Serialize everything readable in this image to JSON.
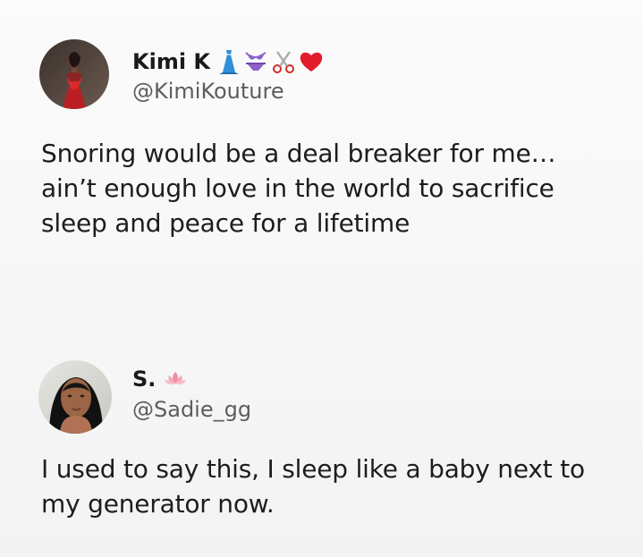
{
  "tweets": [
    {
      "display_name": "Kimi K",
      "name_emojis": [
        "dress-icon",
        "bikini-icon",
        "scissors-icon",
        "red-heart-icon"
      ],
      "handle": "@KimiKouture",
      "text": "Snoring would be a deal breaker for me…\nain’t enough love in the world to sacrifice\nsleep and peace for a lifetime"
    },
    {
      "display_name": "S.",
      "name_emojis": [
        "lotus-icon"
      ],
      "handle": "@Sadie_gg",
      "text": "I used to say this, I sleep like a baby next to\nmy generator now."
    }
  ],
  "colors": {
    "background": "#f7f7f7",
    "text": "#1d1d1d",
    "secondary_text": "#5d5d5d",
    "heart": "#e11d2d",
    "dress": "#2f8fd8",
    "bikini": "#8d63c9",
    "lotus": "#ef8fa2"
  }
}
